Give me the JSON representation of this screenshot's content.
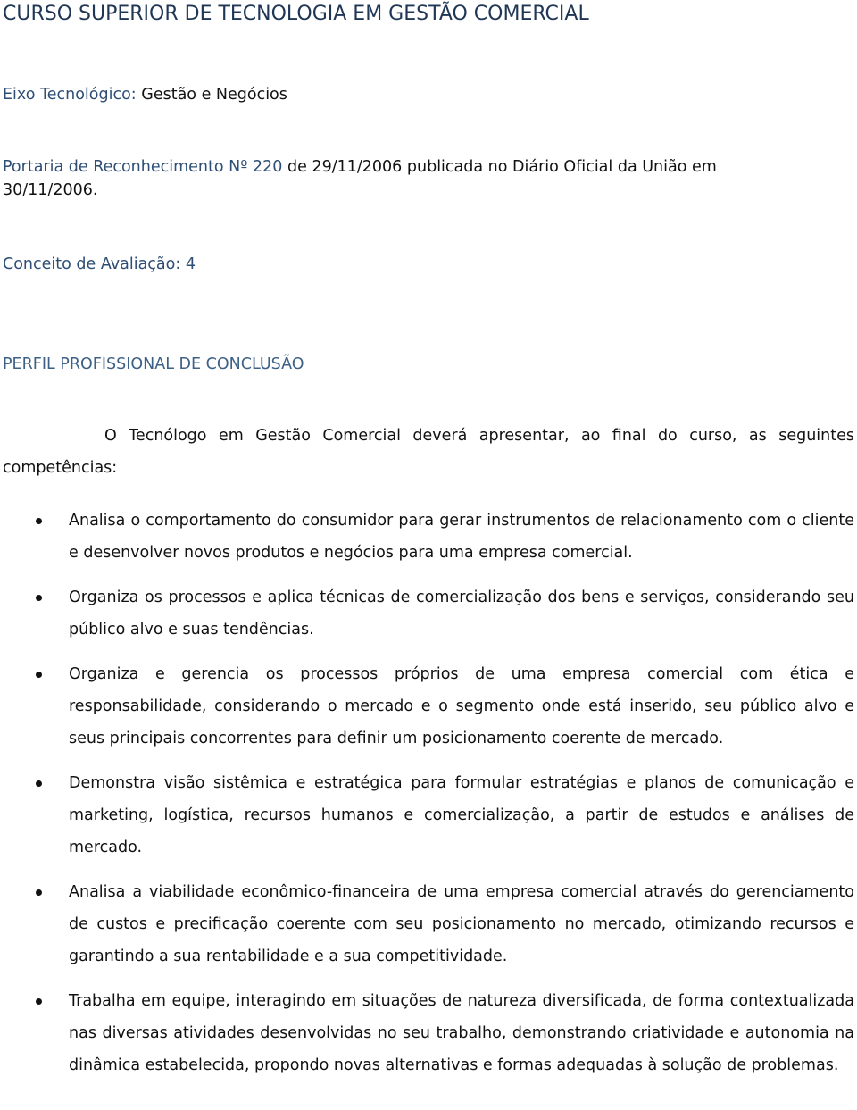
{
  "document": {
    "title": "CURSO SUPERIOR DE TECNOLOGIA EM GESTÃO COMERCIAL",
    "eixo": {
      "label": "Eixo Tecnológico:",
      "value": "Gestão e Negócios"
    },
    "portaria": {
      "label": "Portaria de Reconhecimento Nº 220",
      "text_line1": "de 29/11/2006 publicada no Diário Oficial da União em",
      "text_line2": "30/11/2006."
    },
    "conceito": {
      "label": "Conceito de Avaliação:",
      "value": "4"
    },
    "section_heading": "PERFIL PROFISSIONAL DE CONCLUSÃO",
    "intro": "O Tecnólogo em Gestão Comercial deverá apresentar, ao final do curso, as seguintes competências:",
    "competencies": [
      "Analisa o comportamento do consumidor para gerar instrumentos de relacionamento com o cliente e desenvolver novos produtos e negócios para uma empresa comercial.",
      "Organiza os processos e aplica técnicas de comercialização dos bens e serviços, considerando seu público alvo e suas tendências.",
      "Organiza e gerencia os processos próprios de uma empresa comercial com ética e responsabilidade, considerando o mercado e o segmento onde está inserido, seu público alvo e seus principais concorrentes para definir um posicionamento coerente de mercado.",
      "Demonstra visão sistêmica e estratégica para formular estratégias e planos de comunicação e marketing, logística, recursos humanos e comercialização, a partir de estudos e análises de mercado.",
      "Analisa a viabilidade econômico-financeira de uma empresa comercial através do gerenciamento de custos e precificação coerente com seu posicionamento no mercado, otimizando recursos e garantindo a sua rentabilidade e a sua competitividade.",
      "Trabalha em equipe, interagindo em situações de natureza diversificada, de forma contextualizada nas diversas atividades desenvolvidas no seu trabalho, demonstrando criatividade e autonomia na dinâmica estabelecida, propondo novas alternativas e formas adequadas à solução de problemas."
    ]
  },
  "colors": {
    "title": "#1f3655",
    "label": "#2e4e76",
    "heading": "#3d6086",
    "body_text": "#111111"
  }
}
